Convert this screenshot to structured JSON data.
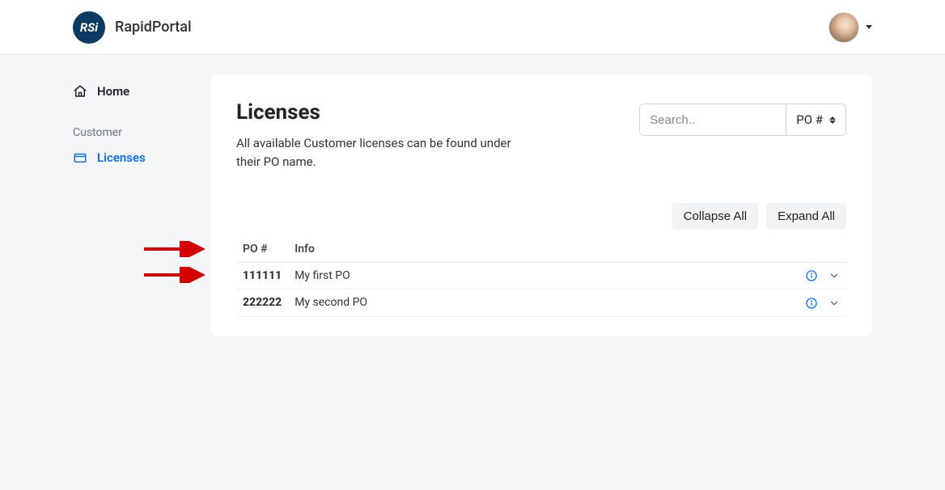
{
  "header": {
    "brand_name": "RapidPortal",
    "brand_logo_text": "RSi"
  },
  "sidebar": {
    "home_label": "Home",
    "customer_section": "Customer",
    "licenses_label": "Licenses"
  },
  "page": {
    "title": "Licenses",
    "description": "All available Customer licenses can be found under their PO name.",
    "search_placeholder": "Search..",
    "search_filter_label": "PO #",
    "collapse_all": "Collapse All",
    "expand_all": "Expand All"
  },
  "table": {
    "headers": {
      "po": "PO #",
      "info": "Info"
    },
    "rows": [
      {
        "po_number": "111111",
        "info": "My first PO"
      },
      {
        "po_number": "222222",
        "info": "My second PO"
      }
    ]
  }
}
